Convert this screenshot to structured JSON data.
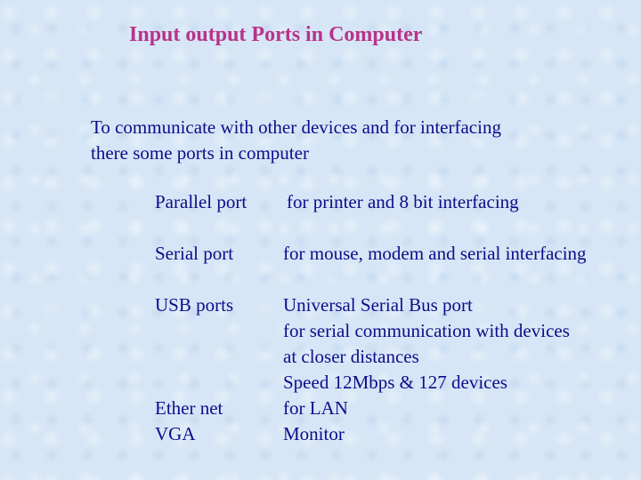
{
  "title": "Input output Ports in Computer",
  "intro": {
    "line1": "To communicate with other devices and for interfacing",
    "line2": "there some ports  in computer"
  },
  "ports": [
    {
      "name": "Parallel port",
      "desc": [
        "for printer and  8 bit interfacing"
      ]
    },
    {
      "name": "Serial port",
      "desc": [
        "for mouse, modem and serial interfacing"
      ]
    },
    {
      "name": "USB ports",
      "desc": [
        "Universal Serial Bus port",
        "for serial communication with devices",
        "at closer distances",
        "Speed 12Mbps & 127 devices"
      ]
    },
    {
      "name": "Ether net",
      "desc": [
        "for LAN"
      ]
    },
    {
      "name": "VGA",
      "desc": [
        "Monitor"
      ]
    }
  ]
}
